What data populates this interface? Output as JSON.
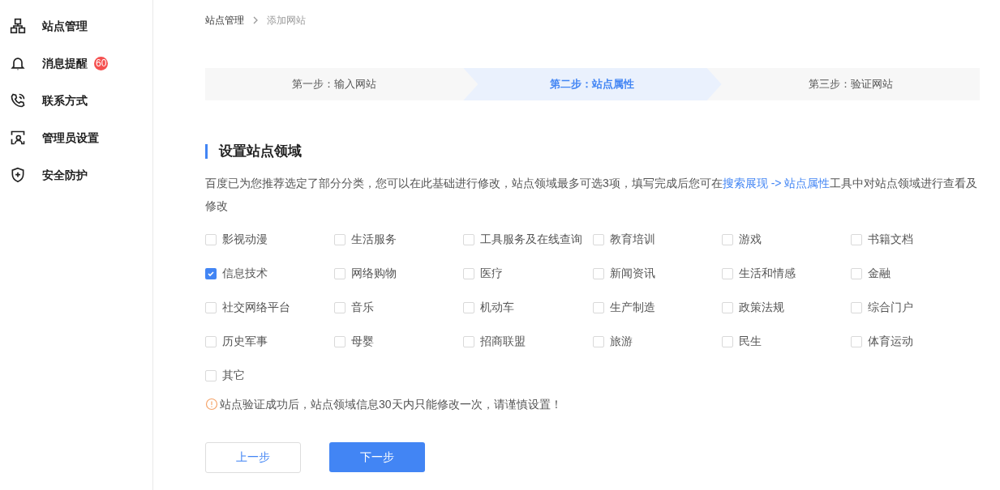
{
  "sidebar": {
    "items": [
      {
        "kind": "sitemap",
        "label": "站点管理"
      },
      {
        "kind": "bell",
        "label": "消息提醒",
        "badge": "60"
      },
      {
        "kind": "phone",
        "label": "联系方式"
      },
      {
        "kind": "admin",
        "label": "管理员设置"
      },
      {
        "kind": "shield",
        "label": "安全防护"
      }
    ]
  },
  "breadcrumb": [
    {
      "label": "站点管理"
    },
    {
      "label": "添加网站"
    }
  ],
  "steps": [
    {
      "label": "第一步：输入网站",
      "selected": false
    },
    {
      "label": "第二步：站点属性",
      "selected": true
    },
    {
      "label": "第三步：验证网站",
      "selected": false
    }
  ],
  "section": {
    "title": "设置站点领域",
    "description": {
      "before": "百度已为您推荐选定了部分分类，您可以在此基础进行修改，站点领域最多可选3项，填写完成后您可在",
      "link": "搜索展现 -> 站点属性",
      "after": "工具中对站点领域进行查看及修改"
    },
    "categories": [
      {
        "label": "影视动漫",
        "checked": false
      },
      {
        "label": "生活服务",
        "checked": false
      },
      {
        "label": "工具服务及在线查询",
        "checked": false
      },
      {
        "label": "教育培训",
        "checked": false
      },
      {
        "label": "游戏",
        "checked": false
      },
      {
        "label": "书籍文档",
        "checked": false
      },
      {
        "label": "信息技术",
        "checked": true
      },
      {
        "label": "网络购物",
        "checked": false
      },
      {
        "label": "医疗",
        "checked": false
      },
      {
        "label": "新闻资讯",
        "checked": false
      },
      {
        "label": "生活和情感",
        "checked": false
      },
      {
        "label": "金融",
        "checked": false
      },
      {
        "label": "社交网络平台",
        "checked": false
      },
      {
        "label": "音乐",
        "checked": false
      },
      {
        "label": "机动车",
        "checked": false
      },
      {
        "label": "生产制造",
        "checked": false
      },
      {
        "label": "政策法规",
        "checked": false
      },
      {
        "label": "综合门户",
        "checked": false
      },
      {
        "label": "历史军事",
        "checked": false
      },
      {
        "label": "母婴",
        "checked": false
      },
      {
        "label": "招商联盟",
        "checked": false
      },
      {
        "label": "旅游",
        "checked": false
      },
      {
        "label": "民生",
        "checked": false
      },
      {
        "label": "体育运动",
        "checked": false
      },
      {
        "label": "其它",
        "checked": false
      }
    ],
    "warning": "站点验证成功后，站点领域信息30天内只能修改一次，请谨慎设置！"
  },
  "buttons": [
    {
      "label": "上一步",
      "kind": "secondary"
    },
    {
      "label": "下一步",
      "kind": "primary"
    }
  ]
}
